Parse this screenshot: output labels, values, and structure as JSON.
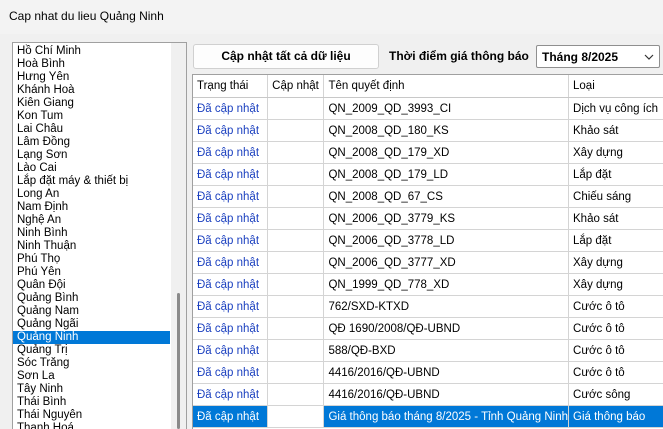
{
  "window": {
    "title": "Cap nhat du lieu Quảng Ninh"
  },
  "provinces": {
    "items": [
      "Hồ Chí Minh",
      "Hoà Bình",
      "Hưng Yên",
      "Khánh Hoà",
      "Kiên Giang",
      "Kon Tum",
      "Lai Châu",
      "Lâm Đồng",
      "Lạng Sơn",
      "Lào Cai",
      "Lắp đặt máy & thiết bị",
      "Long An",
      "Nam Định",
      "Nghệ An",
      "Ninh Bình",
      "Ninh Thuận",
      "Phú Thọ",
      "Phú Yên",
      "Quân Đội",
      "Quảng Bình",
      "Quảng Nam",
      "Quảng Ngãi",
      "Quảng Ninh",
      "Quảng Trị",
      "Sóc Trăng",
      "Sơn La",
      "Tây Ninh",
      "Thái Bình",
      "Thái Nguyên",
      "Thanh Hoá"
    ],
    "selected": "Quảng Ninh"
  },
  "toolbar": {
    "update_all_label": "Cập nhật tất cả dữ liệu",
    "time_label": "Thời điểm giá thông báo",
    "period_value": "Tháng 8/2025"
  },
  "grid": {
    "columns": [
      "Trạng thái",
      "Cập nhật",
      "Tên quyết định",
      "Loại"
    ],
    "rows": [
      {
        "status": "Đã cập nhật",
        "update": "",
        "name": "QN_2009_QD_3993_CI",
        "type": "Dịch vụ công ích"
      },
      {
        "status": "Đã cập nhật",
        "update": "",
        "name": "QN_2008_QD_180_KS",
        "type": "Khảo sát"
      },
      {
        "status": "Đã cập nhật",
        "update": "",
        "name": "QN_2008_QD_179_XD",
        "type": "Xây dựng"
      },
      {
        "status": "Đã cập nhật",
        "update": "",
        "name": "QN_2008_QD_179_LD",
        "type": "Lắp đặt"
      },
      {
        "status": "Đã cập nhật",
        "update": "",
        "name": "QN_2008_QD_67_CS",
        "type": "Chiếu sáng"
      },
      {
        "status": "Đã cập nhật",
        "update": "",
        "name": "QN_2006_QD_3779_KS",
        "type": "Khảo sát"
      },
      {
        "status": "Đã cập nhật",
        "update": "",
        "name": "QN_2006_QD_3778_LD",
        "type": "Lắp đặt"
      },
      {
        "status": "Đã cập nhật",
        "update": "",
        "name": "QN_2006_QD_3777_XD",
        "type": "Xây dựng"
      },
      {
        "status": "Đã cập nhật",
        "update": "",
        "name": "QN_1999_QD_778_XD",
        "type": "Xây dựng"
      },
      {
        "status": "Đã cập nhật",
        "update": "",
        "name": "762/SXD-KTXD",
        "type": "Cước ô tô"
      },
      {
        "status": "Đã cập nhật",
        "update": "",
        "name": "QĐ 1690/2008/QĐ-UBND",
        "type": "Cước ô tô"
      },
      {
        "status": "Đã cập nhật",
        "update": "",
        "name": "588/QĐ-BXD",
        "type": "Cước ô tô"
      },
      {
        "status": "Đã cập nhật",
        "update": "",
        "name": "4416/2016/QĐ-UBND",
        "type": "Cước ô tô"
      },
      {
        "status": "Đã cập nhật",
        "update": "",
        "name": "4416/2016/QĐ-UBND",
        "type": "Cước sông"
      },
      {
        "status": "Đã cập nhật",
        "update": "",
        "name": "Giá thông báo tháng 8/2025 - Tỉnh Quảng Ninh",
        "type": "Giá thông báo",
        "selected": true
      }
    ]
  }
}
